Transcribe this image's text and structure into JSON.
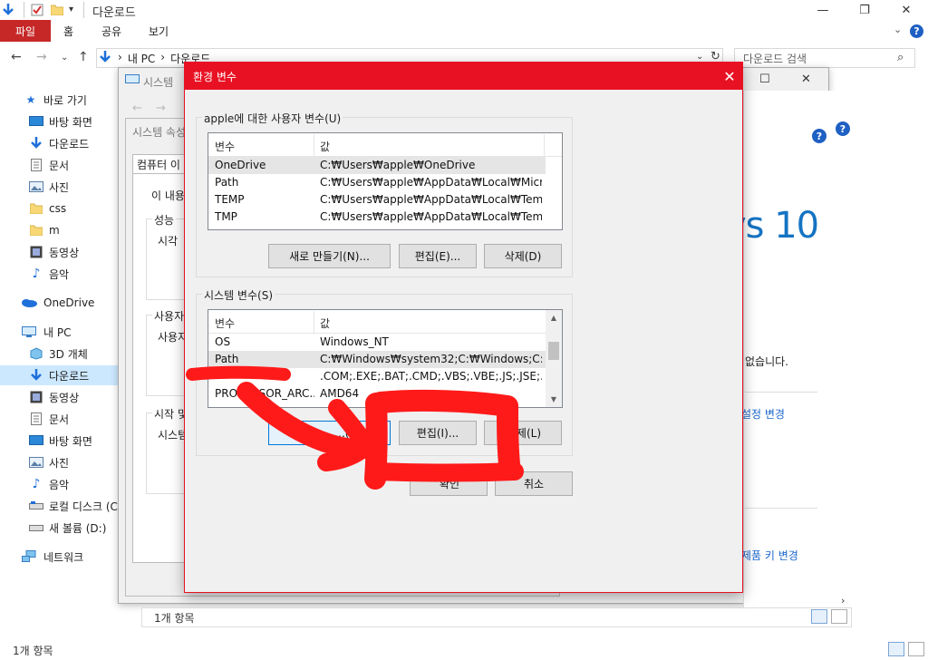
{
  "explorer": {
    "title": "다운로드",
    "ribbon": {
      "file_tab": "파일",
      "tabs": [
        "홈",
        "공유",
        "보기"
      ]
    },
    "address": {
      "segments": [
        "내 PC",
        "다운로드"
      ]
    },
    "search_placeholder": "다운로드 검색",
    "sidebar": {
      "items": [
        {
          "label": "바로 가기",
          "icon": "star-icon"
        },
        {
          "label": "바탕 화면",
          "icon": "desktop-icon"
        },
        {
          "label": "다운로드",
          "icon": "download-icon"
        },
        {
          "label": "문서",
          "icon": "document-icon"
        },
        {
          "label": "사진",
          "icon": "picture-icon"
        },
        {
          "label": "css",
          "icon": "folder-icon"
        },
        {
          "label": "m",
          "icon": "folder-icon"
        },
        {
          "label": "동영상",
          "icon": "video-icon"
        },
        {
          "label": "음악",
          "icon": "music-icon"
        },
        {
          "label": "OneDrive",
          "icon": "cloud-icon"
        },
        {
          "label": "내 PC",
          "icon": "pc-icon"
        },
        {
          "label": "3D 개체",
          "icon": "cube-icon"
        },
        {
          "label": "다운로드",
          "icon": "download-icon"
        },
        {
          "label": "동영상",
          "icon": "video-icon"
        },
        {
          "label": "문서",
          "icon": "document-icon"
        },
        {
          "label": "바탕 화면",
          "icon": "desktop-icon"
        },
        {
          "label": "사진",
          "icon": "picture-icon"
        },
        {
          "label": "음악",
          "icon": "music-icon"
        },
        {
          "label": "로컬 디스크 (C",
          "icon": "drive-icon"
        },
        {
          "label": "새 볼륨 (D:)",
          "icon": "drive-icon"
        },
        {
          "label": "네트워크",
          "icon": "network-icon"
        }
      ]
    },
    "status": "1개 항목",
    "inner_status": "1개 항목"
  },
  "system_window": {
    "title": "시스템",
    "sysprop_title": "시스템 속성",
    "tab": "컴퓨터 이",
    "intro": "이 내용",
    "group1": "성능",
    "group1_text": "시각",
    "group2": "사용자",
    "group2_text": "사용자",
    "group3": "시작 및",
    "group3_text": "시스템",
    "right_text_1": "없습니다.",
    "right_link_1": "설정 변경",
    "right_link_2": "제품 키 변경",
    "win10": "vs 10"
  },
  "env_dialog": {
    "title": "환경 변수",
    "user_group": "apple에 대한 사용자 변수(U)",
    "col_variable": "변수",
    "col_value": "값",
    "user_vars": [
      {
        "name": "OneDrive",
        "value": "C:₩Users₩apple₩OneDrive"
      },
      {
        "name": "Path",
        "value": "C:₩Users₩apple₩AppData₩Local₩Microso..."
      },
      {
        "name": "TEMP",
        "value": "C:₩Users₩apple₩AppData₩Local₩Temp"
      },
      {
        "name": "TMP",
        "value": "C:₩Users₩apple₩AppData₩Local₩Temp"
      }
    ],
    "user_buttons": {
      "new": "새로 만들기(N)...",
      "edit": "편집(E)...",
      "delete": "삭제(D)"
    },
    "system_group": "시스템 변수(S)",
    "system_vars": [
      {
        "name": "OS",
        "value": "Windows_NT"
      },
      {
        "name": "Path",
        "value": "C:₩Windows₩system32;C:₩Windows;C:₩..."
      },
      {
        "name": "",
        "value": ".COM;.EXE;.BAT;.CMD;.VBS;.VBE;.JS;.JSE;.W..."
      },
      {
        "name": "PROCESSOR_ARC...",
        "value": "AMD64"
      }
    ],
    "system_buttons": {
      "new": "...(W)",
      "edit": "편집(I)...",
      "delete": "제(L)"
    },
    "ok": "확인",
    "cancel": "취소"
  },
  "annotation": {
    "color": "#ff1a1a"
  }
}
